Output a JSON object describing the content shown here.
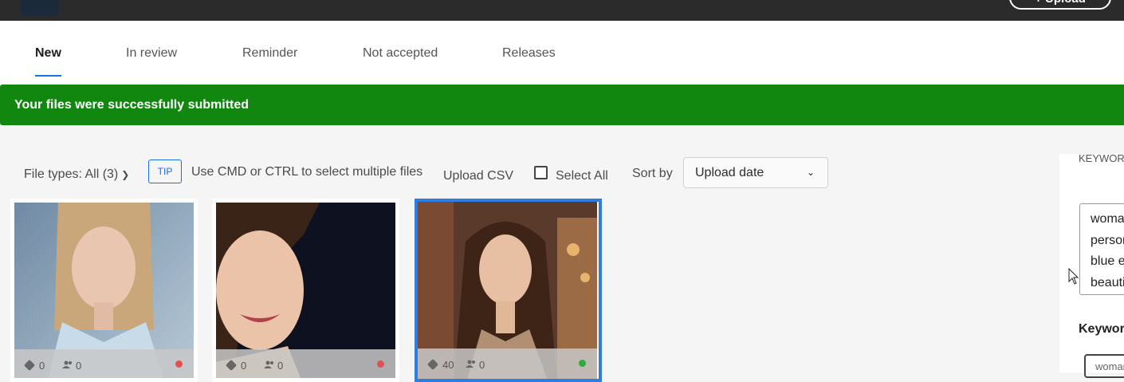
{
  "topbar": {
    "upload_label": "+ Upload"
  },
  "tabs": [
    {
      "label": "New",
      "active": true
    },
    {
      "label": "In review"
    },
    {
      "label": "Reminder"
    },
    {
      "label": "Not accepted"
    },
    {
      "label": "Releases"
    }
  ],
  "banner": {
    "message": "Your files were successfully submitted",
    "color": "#12870f"
  },
  "toolbar": {
    "file_types": "File types: All (3)",
    "tip_badge": "TIP",
    "tip_text": "Use CMD or CTRL to select multiple files",
    "upload_csv": "Upload CSV",
    "select_all": "Select All",
    "sort_label": "Sort by",
    "sort_value": "Upload date"
  },
  "files": [
    {
      "keywords": "0",
      "releases": "0",
      "status": "red",
      "selected": false
    },
    {
      "keywords": "0",
      "releases": "0",
      "status": "red",
      "selected": false
    },
    {
      "keywords": "40",
      "releases": "0",
      "status": "green",
      "selected": true
    }
  ],
  "status_colors": {
    "red": "#e05252",
    "green": "#2eaa3f"
  },
  "accent": "#1473e6",
  "side_panel": {
    "header": "KEYWORDS",
    "keyword_lines": [
      "woman",
      "person",
      "blue eyes",
      "beautiful"
    ],
    "keywords_title": "Keywords",
    "chip": "woman"
  }
}
